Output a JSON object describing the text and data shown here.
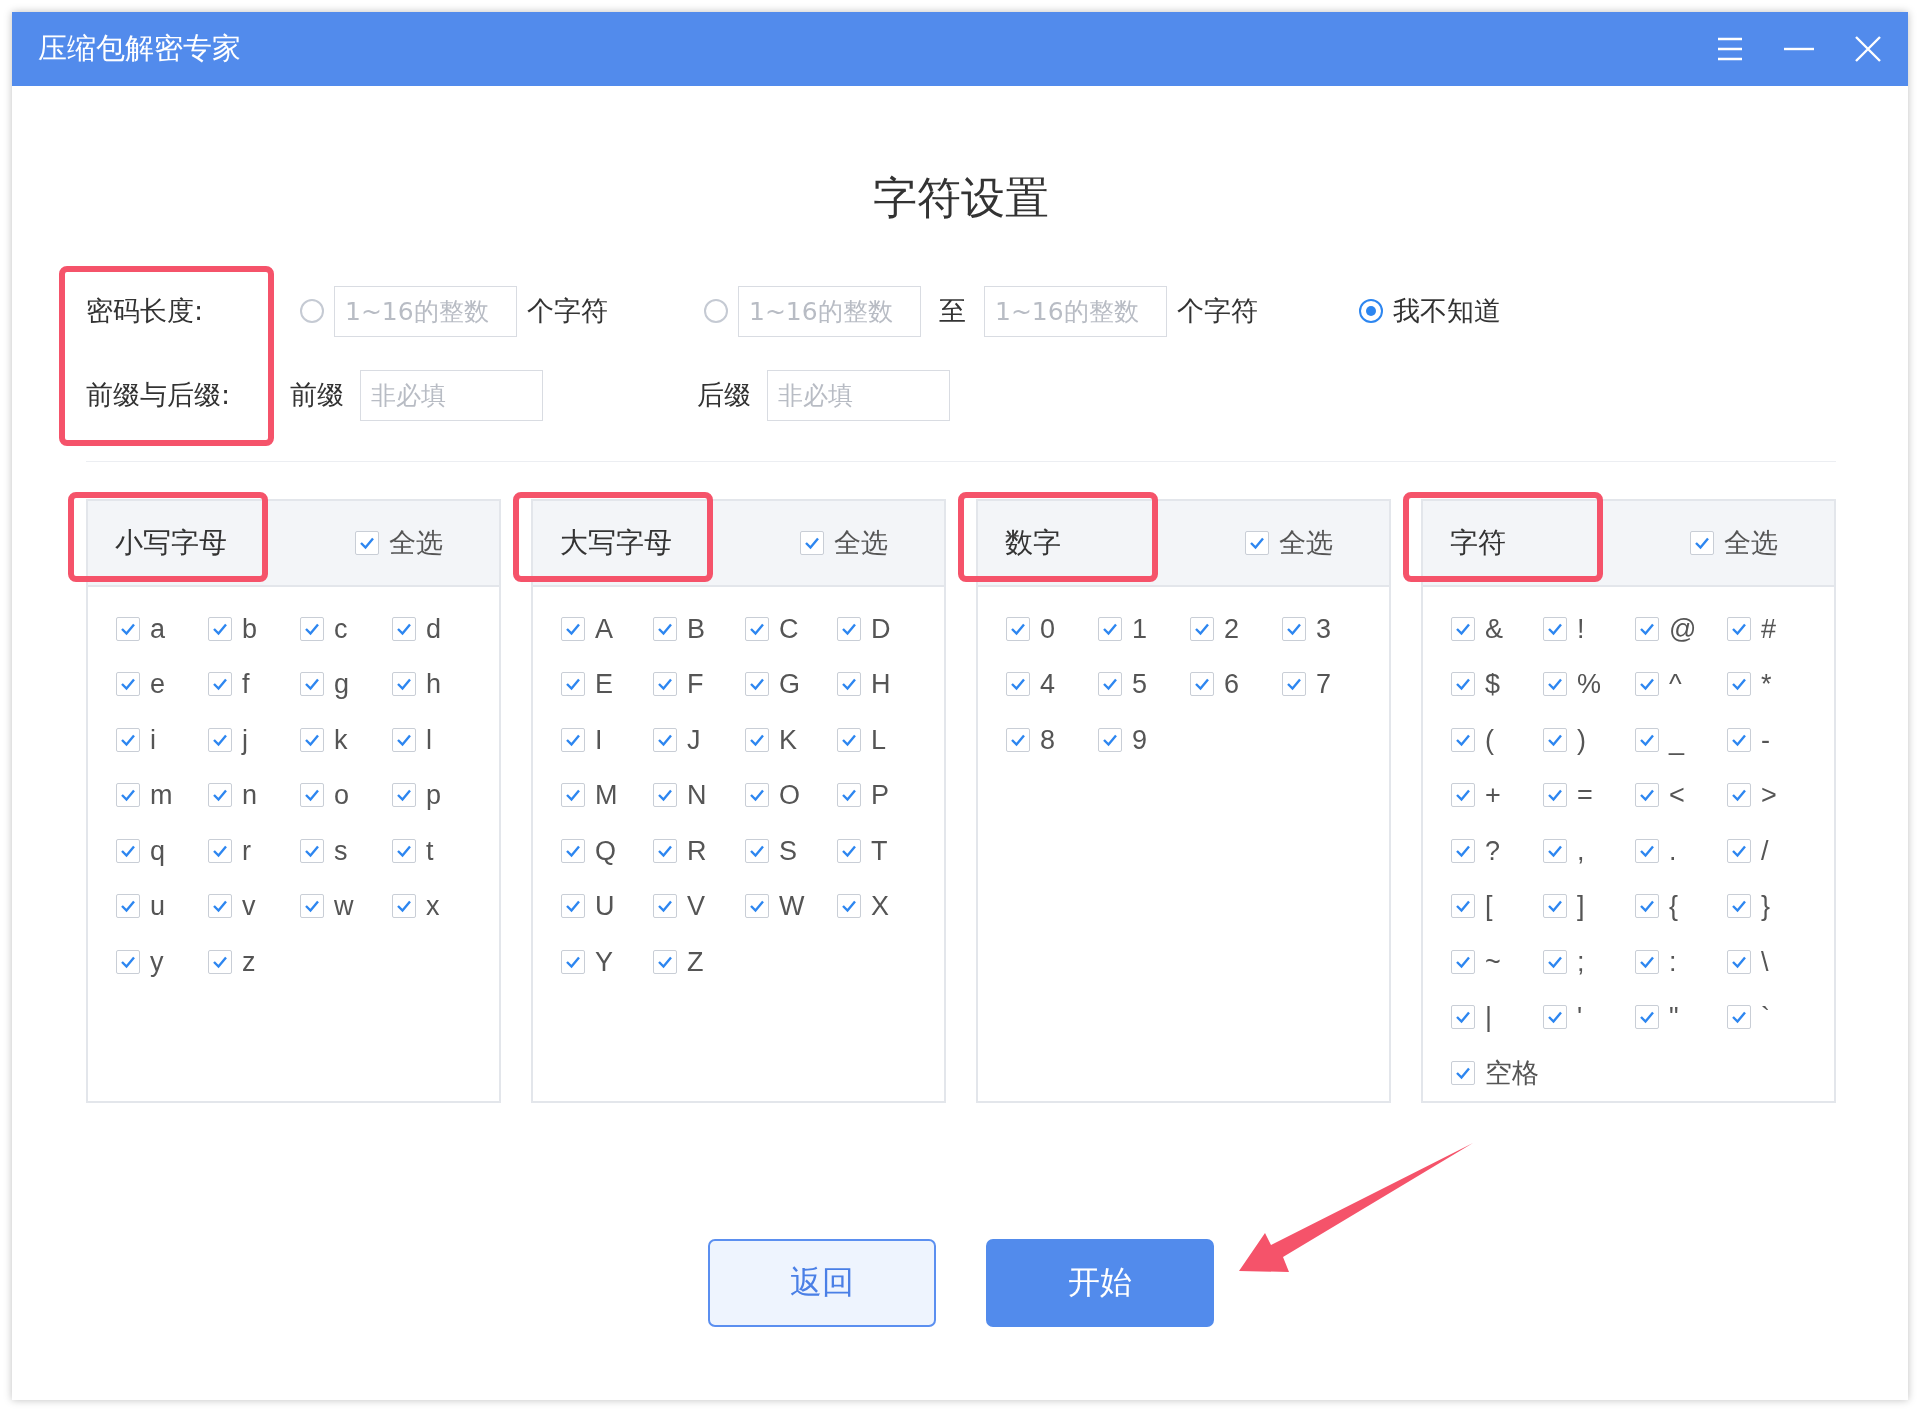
{
  "window": {
    "title": "压缩包解密专家"
  },
  "heading": "字符设置",
  "form": {
    "highlighted": true,
    "length": {
      "label": "密码长度:",
      "options": [
        {
          "kind": "single",
          "selected": false,
          "placeholder": "1~16的整数",
          "suffix": "个字符"
        },
        {
          "kind": "range",
          "selected": false,
          "placeholder_from": "1~16的整数",
          "to": "至",
          "placeholder_to": "1~16的整数",
          "suffix": "个字符"
        },
        {
          "kind": "unknown",
          "selected": true,
          "label": "我不知道"
        }
      ]
    },
    "affix": {
      "label": "前缀与后缀:",
      "fields": [
        {
          "label": "前缀",
          "placeholder": "非必填"
        },
        {
          "label": "后缀",
          "placeholder": "非必填"
        }
      ]
    }
  },
  "panels": [
    {
      "title": "小写字母",
      "highlighted": true,
      "select_all": {
        "label": "全选",
        "checked": true
      },
      "items": [
        {
          "label": "a",
          "checked": true
        },
        {
          "label": "b",
          "checked": true
        },
        {
          "label": "c",
          "checked": true
        },
        {
          "label": "d",
          "checked": true
        },
        {
          "label": "e",
          "checked": true
        },
        {
          "label": "f",
          "checked": true
        },
        {
          "label": "g",
          "checked": true
        },
        {
          "label": "h",
          "checked": true
        },
        {
          "label": "i",
          "checked": true
        },
        {
          "label": "j",
          "checked": true
        },
        {
          "label": "k",
          "checked": true
        },
        {
          "label": "l",
          "checked": true
        },
        {
          "label": "m",
          "checked": true
        },
        {
          "label": "n",
          "checked": true
        },
        {
          "label": "o",
          "checked": true
        },
        {
          "label": "p",
          "checked": true
        },
        {
          "label": "q",
          "checked": true
        },
        {
          "label": "r",
          "checked": true
        },
        {
          "label": "s",
          "checked": true
        },
        {
          "label": "t",
          "checked": true
        },
        {
          "label": "u",
          "checked": true
        },
        {
          "label": "v",
          "checked": true
        },
        {
          "label": "w",
          "checked": true
        },
        {
          "label": "x",
          "checked": true
        },
        {
          "label": "y",
          "checked": true
        },
        {
          "label": "z",
          "checked": true
        }
      ]
    },
    {
      "title": "大写字母",
      "highlighted": true,
      "select_all": {
        "label": "全选",
        "checked": true
      },
      "items": [
        {
          "label": "A",
          "checked": true
        },
        {
          "label": "B",
          "checked": true
        },
        {
          "label": "C",
          "checked": true
        },
        {
          "label": "D",
          "checked": true
        },
        {
          "label": "E",
          "checked": true
        },
        {
          "label": "F",
          "checked": true
        },
        {
          "label": "G",
          "checked": true
        },
        {
          "label": "H",
          "checked": true
        },
        {
          "label": "I",
          "checked": true
        },
        {
          "label": "J",
          "checked": true
        },
        {
          "label": "K",
          "checked": true
        },
        {
          "label": "L",
          "checked": true
        },
        {
          "label": "M",
          "checked": true
        },
        {
          "label": "N",
          "checked": true
        },
        {
          "label": "O",
          "checked": true
        },
        {
          "label": "P",
          "checked": true
        },
        {
          "label": "Q",
          "checked": true
        },
        {
          "label": "R",
          "checked": true
        },
        {
          "label": "S",
          "checked": true
        },
        {
          "label": "T",
          "checked": true
        },
        {
          "label": "U",
          "checked": true
        },
        {
          "label": "V",
          "checked": true
        },
        {
          "label": "W",
          "checked": true
        },
        {
          "label": "X",
          "checked": true
        },
        {
          "label": "Y",
          "checked": true
        },
        {
          "label": "Z",
          "checked": true
        }
      ]
    },
    {
      "title": "数字",
      "highlighted": true,
      "select_all": {
        "label": "全选",
        "checked": true
      },
      "items": [
        {
          "label": "0",
          "checked": true
        },
        {
          "label": "1",
          "checked": true
        },
        {
          "label": "2",
          "checked": true
        },
        {
          "label": "3",
          "checked": true
        },
        {
          "label": "4",
          "checked": true
        },
        {
          "label": "5",
          "checked": true
        },
        {
          "label": "6",
          "checked": true
        },
        {
          "label": "7",
          "checked": true
        },
        {
          "label": "8",
          "checked": true
        },
        {
          "label": "9",
          "checked": true
        }
      ]
    },
    {
      "title": "字符",
      "highlighted": true,
      "select_all": {
        "label": "全选",
        "checked": true
      },
      "items": [
        {
          "label": "&",
          "checked": true
        },
        {
          "label": "!",
          "checked": true
        },
        {
          "label": "@",
          "checked": true
        },
        {
          "label": "#",
          "checked": true
        },
        {
          "label": "$",
          "checked": true
        },
        {
          "label": "%",
          "checked": true
        },
        {
          "label": "^",
          "checked": true
        },
        {
          "label": "*",
          "checked": true
        },
        {
          "label": "(",
          "checked": true
        },
        {
          "label": ")",
          "checked": true
        },
        {
          "label": "_",
          "checked": true
        },
        {
          "label": "-",
          "checked": true
        },
        {
          "label": "+",
          "checked": true
        },
        {
          "label": "=",
          "checked": true
        },
        {
          "label": "<",
          "checked": true
        },
        {
          "label": ">",
          "checked": true
        },
        {
          "label": "?",
          "checked": true
        },
        {
          "label": ",",
          "checked": true
        },
        {
          "label": ".",
          "checked": true
        },
        {
          "label": "/",
          "checked": true
        },
        {
          "label": "[",
          "checked": true
        },
        {
          "label": "]",
          "checked": true
        },
        {
          "label": "{",
          "checked": true
        },
        {
          "label": "}",
          "checked": true
        },
        {
          "label": "~",
          "checked": true
        },
        {
          "label": ";",
          "checked": true
        },
        {
          "label": ":",
          "checked": true
        },
        {
          "label": "\\",
          "checked": true
        },
        {
          "label": "|",
          "checked": true
        },
        {
          "label": "'",
          "checked": true
        },
        {
          "label": "\"",
          "checked": true
        },
        {
          "label": "`",
          "checked": true
        },
        {
          "label": "空格",
          "checked": true
        }
      ]
    }
  ],
  "buttons": [
    {
      "label": "返回",
      "kind": "secondary"
    },
    {
      "label": "开始",
      "kind": "primary"
    }
  ],
  "pointer_arrow": true
}
